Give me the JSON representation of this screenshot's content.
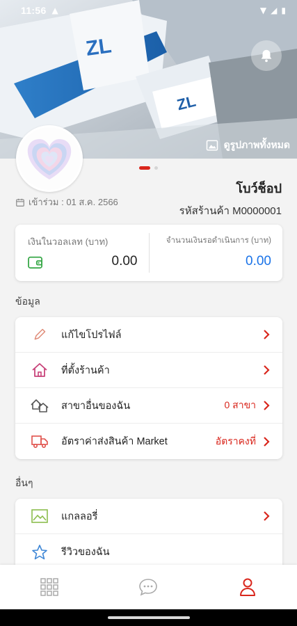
{
  "status_bar": {
    "time": "11:56"
  },
  "hero": {
    "view_all_label": "ดูรูปภาพทั้งหมด",
    "slide_count": 2,
    "active_slide": 1
  },
  "profile": {
    "shop_name": "โบว์ช็อป",
    "joined": "เข้าร่วม : 01 ส.ค. 2566",
    "shop_code": "รหัสร้านค้า M0000001"
  },
  "wallet": {
    "balance_label": "เงินในวอลเลท (บาท)",
    "balance_value": "0.00",
    "pending_label": "จำนวนเงินรอดำเนินการ (บาท)",
    "pending_value": "0.00"
  },
  "sections": {
    "info_title": "ข้อมูล",
    "other_title": "อื่นๆ"
  },
  "info_menu": [
    {
      "label": "แก้ไขโปรไฟล์",
      "value": "",
      "icon": "pencil-icon"
    },
    {
      "label": "ที่ตั้งร้านค้า",
      "value": "",
      "icon": "home-icon"
    },
    {
      "label": "สาขาอื่นของฉัน",
      "value": "0 สาขา",
      "icon": "branches-icon"
    },
    {
      "label": "อัตราค่าส่งสินค้า Market",
      "value": "อัตราคงที่",
      "icon": "delivery-truck-icon"
    }
  ],
  "other_menu": [
    {
      "label": "แกลลอรี่",
      "value": "",
      "icon": "gallery-icon"
    },
    {
      "label": "รีวิวของฉัน",
      "value": "",
      "icon": "star-icon"
    }
  ],
  "bottom_nav": [
    {
      "name": "grid-icon",
      "active": false
    },
    {
      "name": "chat-icon",
      "active": false
    },
    {
      "name": "profile-icon",
      "active": true
    }
  ],
  "colors": {
    "accent": "#d9261c",
    "blue": "#1a73e8",
    "green": "#3aa94a"
  }
}
